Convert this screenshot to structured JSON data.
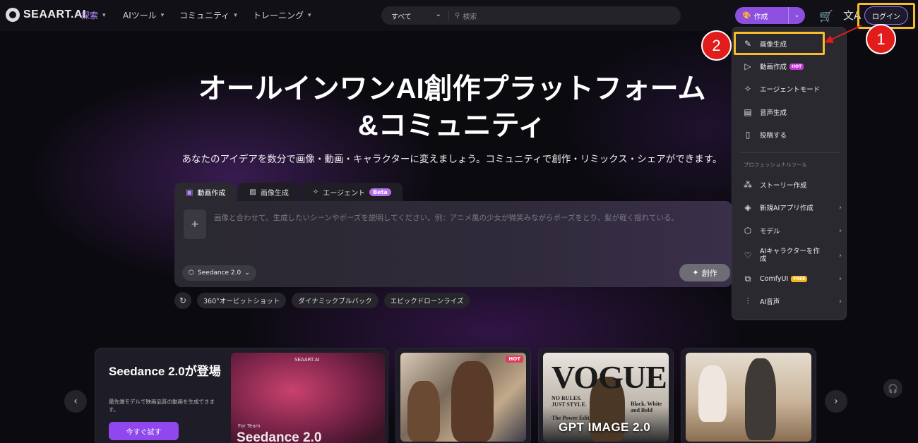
{
  "nav": {
    "logo": "SEAART.AI",
    "items": [
      {
        "label": "探索",
        "active": true
      },
      {
        "label": "AIツール"
      },
      {
        "label": "コミュニティ"
      },
      {
        "label": "トレーニング"
      }
    ],
    "search_scope": "すべて",
    "search_placeholder": "検索",
    "create_label": "作成",
    "login_label": "ログイン"
  },
  "annotations": {
    "step1": "1",
    "step2": "2",
    "highlight_color": "#f6bd2a",
    "badge_color": "#e21b1b"
  },
  "hero": {
    "title_line1": "オールインワンAI創作プラットフォーム",
    "title_line2": "&コミュニティ",
    "subtitle": "あなたのアイデアを数分で画像・動画・キャラクターに変えましょう。コミュニティで創作・リミックス・シェアができます。"
  },
  "composer": {
    "tabs": [
      {
        "label": "動画作成",
        "active": true
      },
      {
        "label": "画像生成"
      },
      {
        "label": "エージェント",
        "badge": "Beta"
      }
    ],
    "add_label": "+",
    "placeholder": "画像と合わせて、生成したいシーンやポーズを説明してください。例：アニメ風の少女が微笑みながらポーズをとり、髪が軽く揺れている。",
    "model": "Seedance 2.0",
    "submit_label": "創作"
  },
  "suggestions": [
    "360°オービットショット",
    "ダイナミックブルバック",
    "エピックドローンライズ"
  ],
  "feature_card": {
    "title": "Seedance 2.0が登場",
    "description": "最先端モデルで映画品質の動画を生成できます。",
    "button": "今すぐ試す",
    "image_brand": "SEAART.AI",
    "image_for": "For Team",
    "image_title": "Seedance 2.0"
  },
  "thumbs": [
    {
      "badge": "HOT"
    },
    {
      "magazine": "VOGUE",
      "left_text": "NO RULES. JUST STYLE.",
      "right_text": "Black, White and Bold",
      "power_text": "The Power Edit",
      "caption": "GPT IMAGE 2.0"
    },
    {}
  ],
  "menu": {
    "primary": [
      {
        "label": "画像生成",
        "icon": "brush-icon"
      },
      {
        "label": "動画作成",
        "icon": "play-circle-icon",
        "tag": "HOT"
      },
      {
        "label": "エージェントモード",
        "icon": "sparkle-icon"
      },
      {
        "label": "音声生成",
        "icon": "audio-wave-icon"
      },
      {
        "label": "投稿する",
        "icon": "post-icon"
      }
    ],
    "section_label": "プロフェッショナルツール",
    "pro": [
      {
        "label": "ストーリー作成",
        "icon": "magic-wand-icon"
      },
      {
        "label": "新規AIアプリ作成",
        "icon": "app-icon",
        "arrow": true
      },
      {
        "label": "モデル",
        "icon": "cube-icon",
        "arrow": true
      },
      {
        "label": "AIキャラクターを作成",
        "icon": "heart-character-icon",
        "arrow": true
      },
      {
        "label": "ComfyUI",
        "icon": "workflow-icon",
        "tag": "FREE",
        "arrow": true
      },
      {
        "label": "AI音声",
        "icon": "voice-icon",
        "arrow": true
      }
    ]
  }
}
